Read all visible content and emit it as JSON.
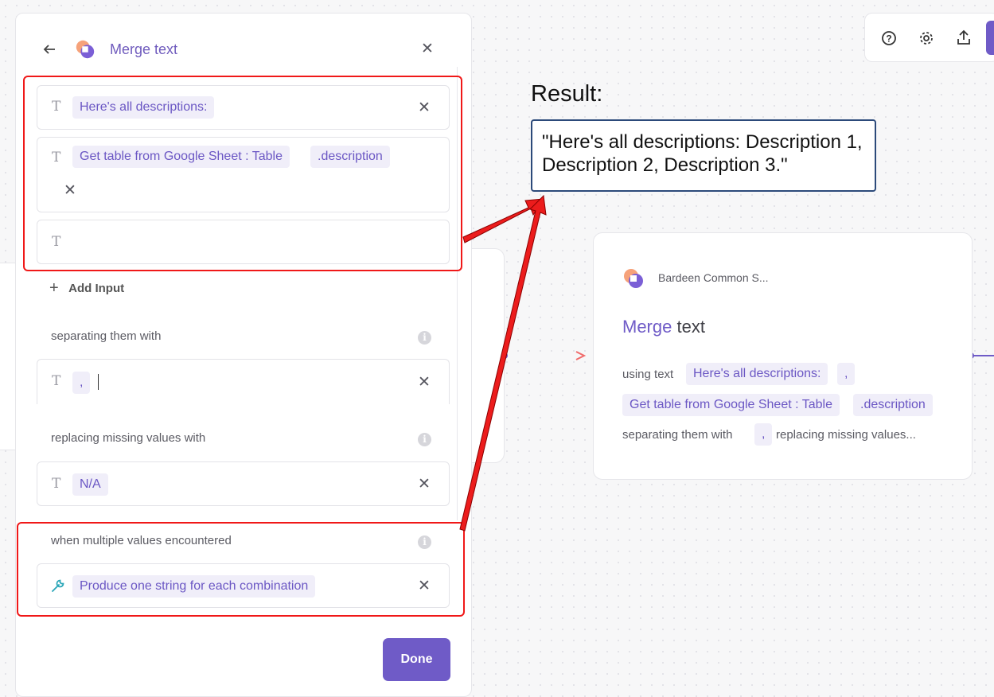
{
  "panel": {
    "title": "Merge text",
    "inputs": [
      {
        "chips": [
          "Here's all descriptions:"
        ]
      },
      {
        "chips": [
          "Get table from Google Sheet : Table",
          ".description"
        ]
      },
      {
        "chips": []
      }
    ],
    "add_input_label": "Add Input",
    "separator": {
      "label": "separating them with",
      "value": ","
    },
    "missing": {
      "label": "replacing missing values with",
      "value": "N/A"
    },
    "multiple": {
      "label": "when multiple values encountered",
      "value": "Produce one string for each combination"
    },
    "done_label": "Done"
  },
  "annotation": {
    "result_label": "Result:",
    "result_text": "\"Here's all descriptions: Description 1, Description 2, Description 3.\""
  },
  "node_card": {
    "app_name": "Bardeen Common S...",
    "title_accent": "Merge",
    "title_rest": "text",
    "using_text_label": "using text",
    "chip_descriptions": "Here's all descriptions:",
    "chip_comma": ",",
    "chip_table": "Get table from Google Sheet : Table",
    "chip_description": ".description",
    "separating_label": "separating them with",
    "separating_value": ",",
    "replacing_label": "replacing missing values..."
  },
  "colors": {
    "accent": "#6f5bc7",
    "annotation_red": "#f01818"
  }
}
